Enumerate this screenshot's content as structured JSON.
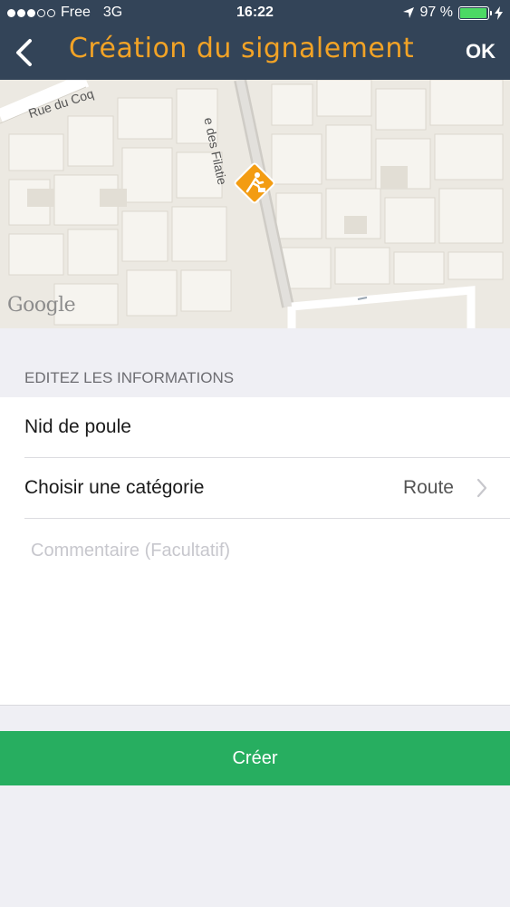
{
  "status_bar": {
    "carrier": "Free",
    "network": "3G",
    "time": "16:22",
    "battery_text": "97 %",
    "battery_level": 0.97
  },
  "nav": {
    "title": "Création du signalement",
    "confirm_label": "OK",
    "title_color": "#f2a326",
    "bar_color": "#334458"
  },
  "map": {
    "street_1": "Rue du Coq",
    "street_2": "e des Filatie",
    "provider": "Google",
    "marker_icon": "roadwork-warning-icon",
    "marker_color": "#f39c12"
  },
  "form": {
    "section_header": "EDITEZ LES INFORMATIONS",
    "title_value": "Nid de poule",
    "category_label": "Choisir une catégorie",
    "category_value": "Route",
    "comment_placeholder": "Commentaire (Facultatif)"
  },
  "actions": {
    "create_label": "Créer",
    "create_color": "#27ae60"
  }
}
